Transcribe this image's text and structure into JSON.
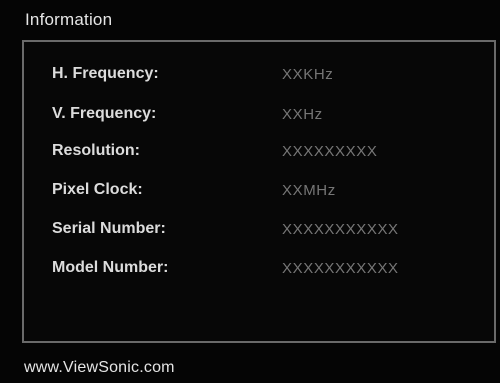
{
  "title": "Information",
  "rows": [
    {
      "label": "H. Frequency:",
      "value": "XXKHz"
    },
    {
      "label": "V. Frequency:",
      "value": "XXHz"
    },
    {
      "label": "Resolution:",
      "value": "XXXXXXXXX"
    },
    {
      "label": "Pixel Clock:",
      "value": "XXMHz"
    },
    {
      "label": "Serial Number:",
      "value": "XXXXXXXXXXX"
    },
    {
      "label": "Model Number:",
      "value": "XXXXXXXXXXX"
    }
  ],
  "footer": "www.ViewSonic.com"
}
